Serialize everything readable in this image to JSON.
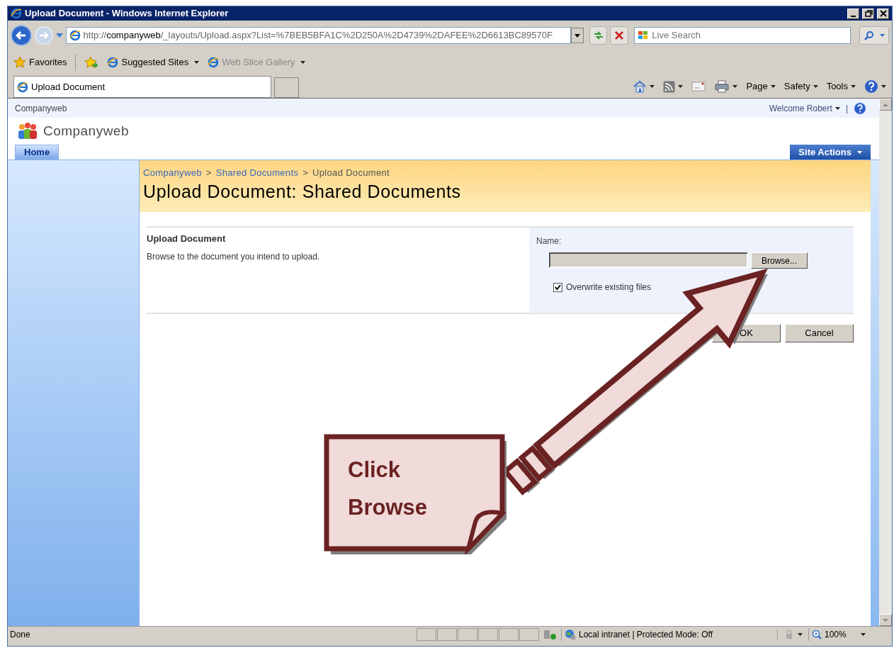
{
  "window": {
    "title": "Upload Document - Windows Internet Explorer"
  },
  "address_bar": {
    "url_prefix": "http://",
    "url_host": "companyweb",
    "url_rest": "/_layouts/Upload.aspx?List=%7BEB5BFA1C%2D250A%2D4739%2DAFEE%2D6613BC89570F"
  },
  "search": {
    "placeholder": "Live Search"
  },
  "favorites_bar": [
    {
      "label": "Favorites",
      "kind": "star",
      "disabled": false
    },
    {
      "label": "Suggested Sites",
      "kind": "ie",
      "disabled": false
    },
    {
      "label": "Web Slice Gallery",
      "kind": "page",
      "disabled": true
    }
  ],
  "tabs": [
    {
      "label": "Upload Document",
      "selected": true
    }
  ],
  "command_bar": [
    "Page",
    "Safety",
    "Tools"
  ],
  "site": {
    "top_link": "Companyweb",
    "welcome": "Welcome Robert",
    "separator": "|",
    "title": "Companyweb",
    "nav_tabs": [
      {
        "label": "Home",
        "selected": true
      }
    ],
    "site_actions": "Site Actions"
  },
  "breadcrumb": [
    {
      "label": "Companyweb",
      "link": true
    },
    {
      "label": "Shared Documents",
      "link": true
    },
    {
      "label": "Upload Document",
      "link": false
    }
  ],
  "breadcrumb_separator": ">",
  "page_title": "Upload Document: Shared Documents",
  "form": {
    "section_title": "Upload Document",
    "section_description": "Browse to the document you intend to upload.",
    "name_label": "Name:",
    "browse_button": "Browse...",
    "overwrite": {
      "label": "Overwrite existing files",
      "checked": true
    }
  },
  "buttons": [
    "OK",
    "Cancel"
  ],
  "callout": {
    "text": "Click Browse"
  },
  "status_bar": {
    "status": "Done",
    "zone": "Local intranet | Protected Mode: Off",
    "zoom": "100%"
  }
}
